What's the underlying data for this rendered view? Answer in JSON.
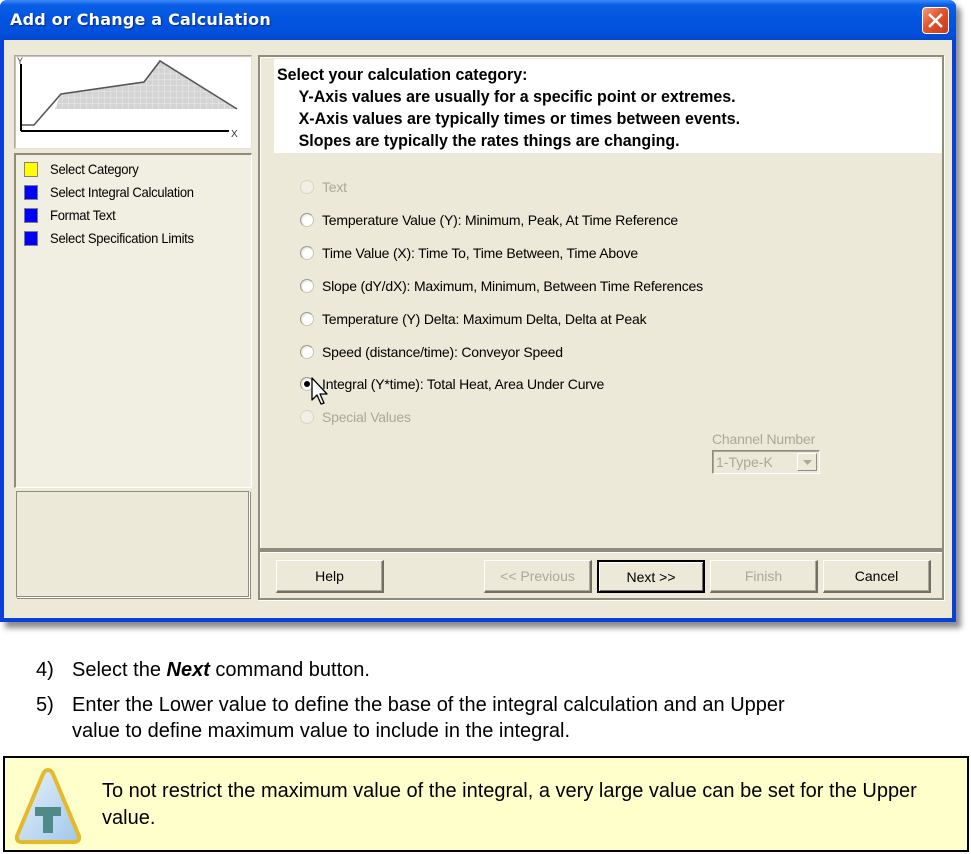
{
  "window": {
    "title": "Add or Change a Calculation",
    "close_icon": "close-x-icon"
  },
  "preview": {
    "y_axis_label": "Y",
    "x_axis_label": "X",
    "description": "Profile curve with shaded integral area"
  },
  "steps": [
    {
      "label": "Select Category",
      "color": "#ffff00",
      "current": true
    },
    {
      "label": "Select Integral Calculation",
      "color": "#0000ff",
      "current": false
    },
    {
      "label": "Format Text",
      "color": "#0000ff",
      "current": false
    },
    {
      "label": "Select Specification Limits",
      "color": "#0000ff",
      "current": false
    }
  ],
  "intro": {
    "heading": "Select your calculation category:",
    "lines": [
      "Y-Axis values are usually for a specific point or extremes.",
      "X-Axis values are typically times or times between events.",
      "Slopes are typically the rates things are changing."
    ]
  },
  "options": [
    {
      "label": "Text",
      "enabled": false,
      "selected": false
    },
    {
      "label": "Temperature Value (Y):  Minimum, Peak, At Time Reference",
      "enabled": true,
      "selected": false
    },
    {
      "label": "Time Value (X):  Time To, Time Between, Time Above",
      "enabled": true,
      "selected": false
    },
    {
      "label": "Slope (dY/dX):  Maximum, Minimum, Between Time References",
      "enabled": true,
      "selected": false
    },
    {
      "label": "Temperature (Y) Delta:  Maximum Delta, Delta at Peak",
      "enabled": true,
      "selected": false
    },
    {
      "label": "Speed (distance/time): Conveyor Speed",
      "enabled": true,
      "selected": false
    },
    {
      "label": "Integral (Y*time): Total Heat, Area Under Curve",
      "enabled": true,
      "selected": true
    },
    {
      "label": "Special  Values",
      "enabled": false,
      "selected": false
    }
  ],
  "channel": {
    "label": "Channel Number",
    "value": "1-Type-K",
    "enabled": false
  },
  "buttons": {
    "help": "Help",
    "previous": "<< Previous",
    "next": "Next >>",
    "finish": "Finish",
    "cancel": "Cancel"
  },
  "doc": {
    "step4": {
      "number": "4)",
      "prefix": "Select the ",
      "emphasis": "Next",
      "suffix": " command button."
    },
    "step5": {
      "number": "5)",
      "line1": "Enter the Lower value to define the base of the integral calculation and an Upper",
      "line2": "value to define maximum value to include in the integral."
    },
    "tip": {
      "icon": "tip-hammer-icon",
      "text": "To not restrict the maximum value of the integral, a very large value can be set for the Upper value."
    }
  }
}
